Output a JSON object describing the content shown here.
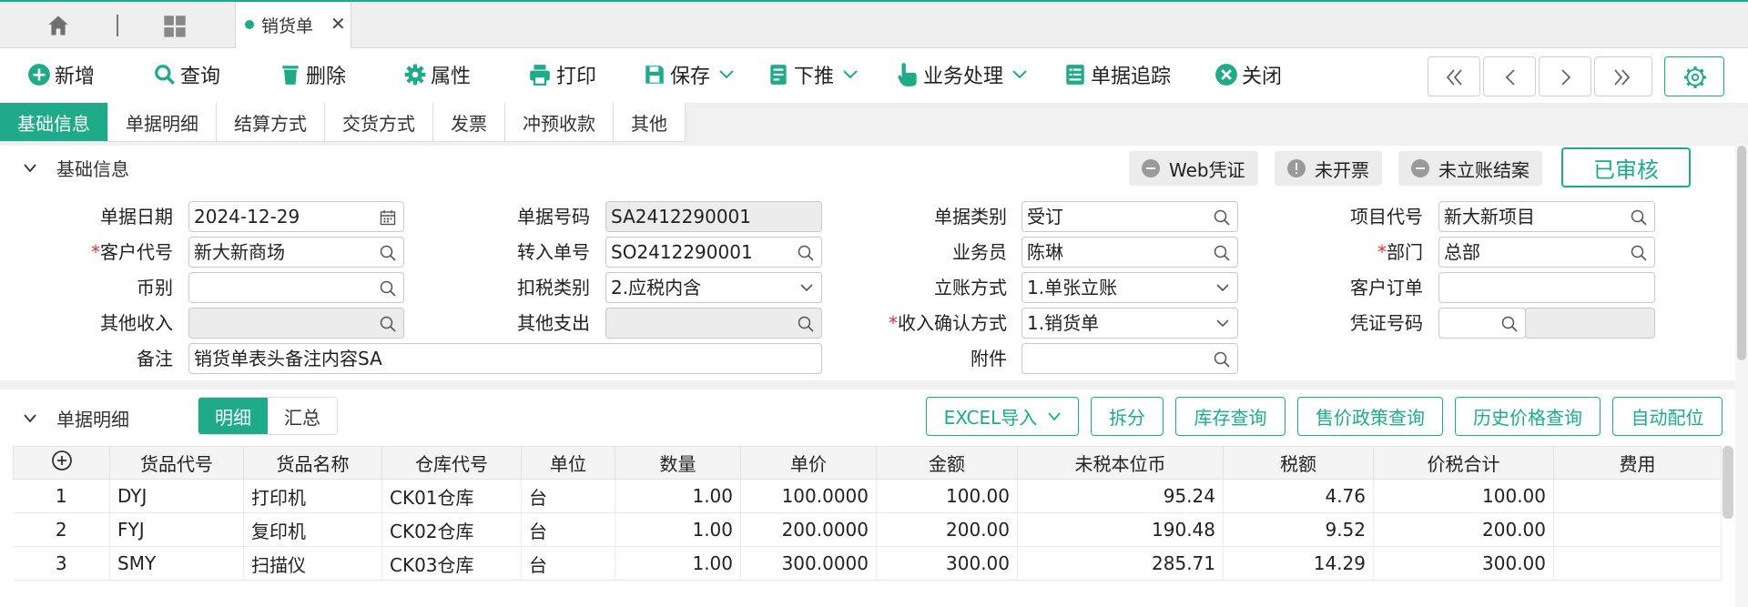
{
  "tabbar": {
    "active_tab": "销货单",
    "close_glyph": "✕"
  },
  "toolbar": {
    "new": "新增",
    "query": "查询",
    "delete": "删除",
    "props": "属性",
    "print": "打印",
    "save": "保存",
    "push": "下推",
    "biz": "业务处理",
    "trace": "单据追踪",
    "close": "关闭"
  },
  "sectabs": [
    "基础信息",
    "单据明细",
    "结算方式",
    "交货方式",
    "发票",
    "冲预收款",
    "其他"
  ],
  "basic": {
    "title": "基础信息",
    "chips": [
      "Web凭证",
      "未开票",
      "未立账结案"
    ],
    "status": "已审核",
    "fields": {
      "doc_date": {
        "label": "单据日期",
        "value": "2024-12-29"
      },
      "doc_no": {
        "label": "单据号码",
        "value": "SA2412290001"
      },
      "doc_type": {
        "label": "单据类别",
        "value": "受订"
      },
      "project": {
        "label": "项目代号",
        "value": "新大新项目"
      },
      "customer": {
        "label": "客户代号",
        "value": "新大新商场"
      },
      "in_no": {
        "label": "转入单号",
        "value": "SO2412290001"
      },
      "salesman": {
        "label": "业务员",
        "value": "陈琳"
      },
      "dept": {
        "label": "部门",
        "value": "总部"
      },
      "currency": {
        "label": "币别",
        "value": ""
      },
      "tax_type": {
        "label": "扣税类别",
        "value": "2.应税内含"
      },
      "account_way": {
        "label": "立账方式",
        "value": "1.单张立账"
      },
      "cust_order": {
        "label": "客户订单",
        "value": ""
      },
      "other_income": {
        "label": "其他收入",
        "value": ""
      },
      "other_expense": {
        "label": "其他支出",
        "value": ""
      },
      "recv_way": {
        "label": "收入确认方式",
        "value": "1.销货单"
      },
      "voucher": {
        "label": "凭证号码",
        "value": ""
      },
      "remark": {
        "label": "备注",
        "value": "销货单表头备注内容SA"
      },
      "attach": {
        "label": "附件",
        "value": ""
      }
    }
  },
  "detail": {
    "title": "单据明细",
    "seg": [
      "明细",
      "汇总"
    ],
    "actions": [
      "EXCEL导入",
      "拆分",
      "库存查询",
      "售价政策查询",
      "历史价格查询",
      "自动配位"
    ],
    "columns": [
      "货品代号",
      "货品名称",
      "仓库代号",
      "单位",
      "数量",
      "单价",
      "金额",
      "未税本位币",
      "税额",
      "价税合计",
      "费用"
    ],
    "rows": [
      [
        "1",
        "DYJ",
        "打印机",
        "CK01仓库",
        "台",
        "1.00",
        "100.0000",
        "100.00",
        "95.24",
        "4.76",
        "100.00",
        ""
      ],
      [
        "2",
        "FYJ",
        "复印机",
        "CK02仓库",
        "台",
        "1.00",
        "200.0000",
        "200.00",
        "190.48",
        "9.52",
        "200.00",
        ""
      ],
      [
        "3",
        "SMY",
        "扫描仪",
        "CK03仓库",
        "台",
        "1.00",
        "300.0000",
        "300.00",
        "285.71",
        "14.29",
        "300.00",
        ""
      ]
    ]
  },
  "colors": {
    "accent": "#1fab89",
    "required": "#e03030"
  }
}
